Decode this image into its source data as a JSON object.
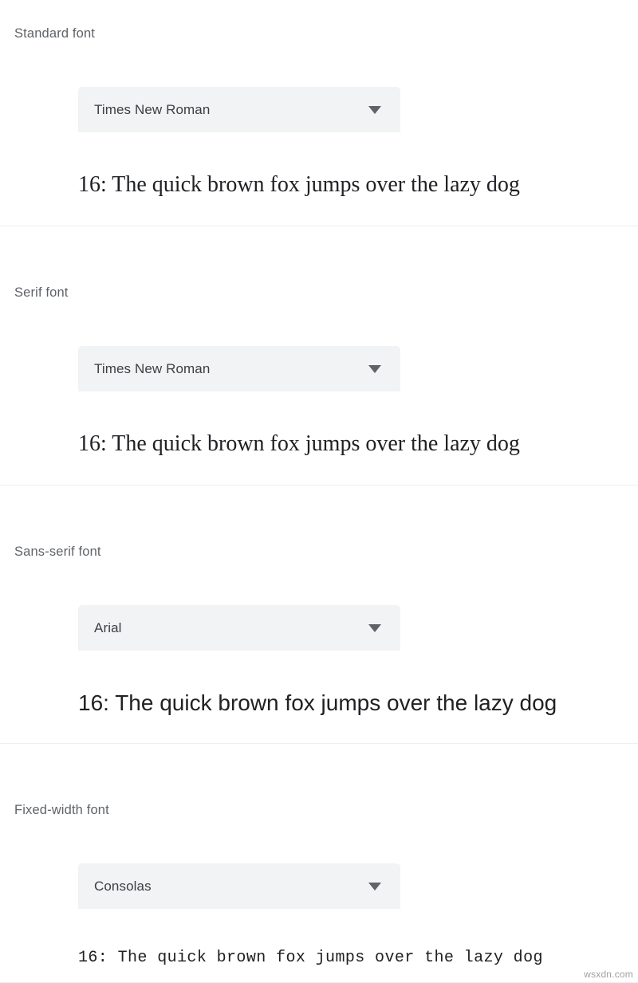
{
  "page": {
    "background_color": "#ffffff",
    "divider_color": "#eceff1",
    "label_color": "#5f6368",
    "dropdown_bg_color": "#f1f3f4",
    "dropdown_text_color": "#3c4043",
    "sample_text_color": "#202124",
    "watermark": "wsxdn.com"
  },
  "sections": [
    {
      "id": "standard",
      "label": "Standard font",
      "dropdown": {
        "name": "standard-font-select",
        "value": "Times New Roman",
        "arrow_icon": "chevron-down-icon"
      },
      "sample": {
        "size": "16",
        "text": "16: The quick brown fox jumps over the lazy dog"
      }
    },
    {
      "id": "serif",
      "label": "Serif font",
      "dropdown": {
        "name": "serif-font-select",
        "value": "Times New Roman",
        "arrow_icon": "chevron-down-icon"
      },
      "sample": {
        "size": "16",
        "text": "16: The quick brown fox jumps over the lazy dog"
      }
    },
    {
      "id": "sans-serif",
      "label": "Sans-serif font",
      "dropdown": {
        "name": "sans-serif-font-select",
        "value": "Arial",
        "arrow_icon": "chevron-down-icon"
      },
      "sample": {
        "size": "16",
        "text": "16: The quick brown fox jumps over the lazy dog"
      }
    },
    {
      "id": "fixed-width",
      "label": "Fixed-width font",
      "dropdown": {
        "name": "fixed-width-font-select",
        "value": "Consolas",
        "arrow_icon": "chevron-down-icon"
      },
      "sample": {
        "size": "16",
        "text": "16: The quick brown fox jumps over the lazy dog"
      }
    }
  ]
}
